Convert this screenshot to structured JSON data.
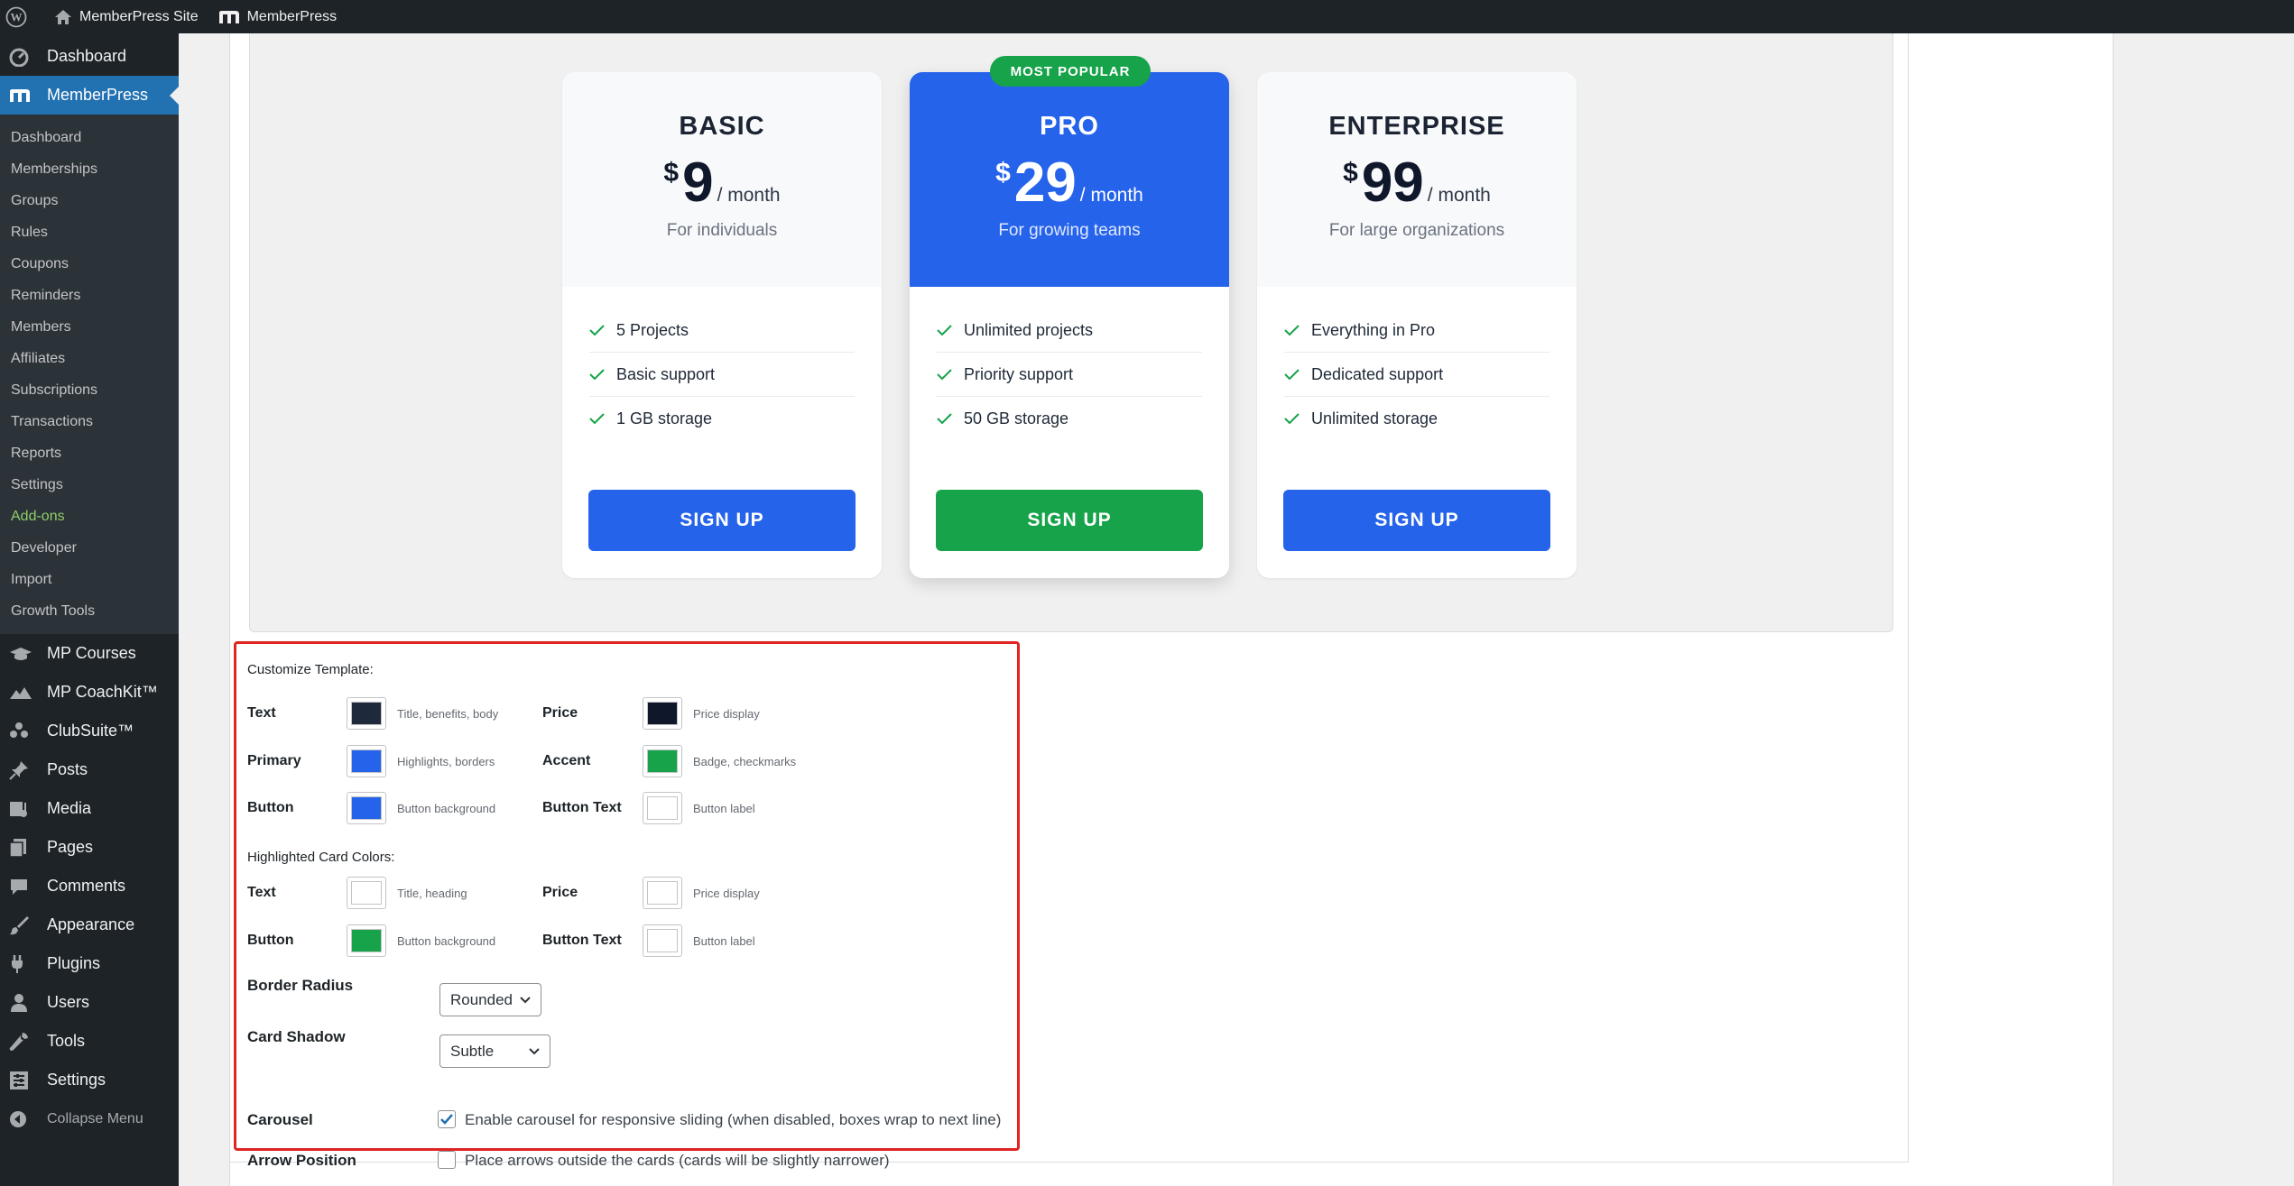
{
  "adminbar": {
    "site_name": "MemberPress Site",
    "plugin_name": "MemberPress"
  },
  "sidebar": {
    "top_items": [
      {
        "label": "Dashboard",
        "icon": "dashboard-icon"
      },
      {
        "label": "MemberPress",
        "icon": "memberpress-icon",
        "current": true
      }
    ],
    "sub_items": [
      "Dashboard",
      "Memberships",
      "Groups",
      "Rules",
      "Coupons",
      "Reminders",
      "Members",
      "Affiliates",
      "Subscriptions",
      "Transactions",
      "Reports",
      "Settings",
      "Add-ons",
      "Developer",
      "Import",
      "Growth Tools"
    ],
    "bottom_items": [
      {
        "label": "MP Courses",
        "icon": "courses-icon"
      },
      {
        "label": "MP CoachKit™",
        "icon": "coachkit-icon"
      },
      {
        "label": "ClubSuite™",
        "icon": "clubsuite-icon"
      },
      {
        "label": "Posts",
        "icon": "pin-icon"
      },
      {
        "label": "Media",
        "icon": "media-icon"
      },
      {
        "label": "Pages",
        "icon": "pages-icon"
      },
      {
        "label": "Comments",
        "icon": "comment-icon"
      },
      {
        "label": "Appearance",
        "icon": "brush-icon"
      },
      {
        "label": "Plugins",
        "icon": "plugin-icon"
      },
      {
        "label": "Users",
        "icon": "user-icon"
      },
      {
        "label": "Tools",
        "icon": "wrench-icon"
      },
      {
        "label": "Settings",
        "icon": "settings-icon"
      }
    ],
    "collapse_label": "Collapse Menu"
  },
  "pricing": {
    "badge": "MOST POPULAR",
    "plans": [
      {
        "title": "BASIC",
        "currency": "$",
        "amount": "9",
        "period": "/ month",
        "desc": "For individuals",
        "features": [
          "5 Projects",
          "Basic support",
          "1 GB storage"
        ],
        "button": "SIGN UP"
      },
      {
        "title": "PRO",
        "currency": "$",
        "amount": "29",
        "period": "/ month",
        "desc": "For growing teams",
        "features": [
          "Unlimited projects",
          "Priority support",
          "50 GB storage"
        ],
        "button": "SIGN UP"
      },
      {
        "title": "ENTERPRISE",
        "currency": "$",
        "amount": "99",
        "period": "/ month",
        "desc": "For large organizations",
        "features": [
          "Everything in Pro",
          "Dedicated support",
          "Unlimited storage"
        ],
        "button": "SIGN UP"
      }
    ]
  },
  "customize": {
    "title": "Customize Template:",
    "colors": [
      {
        "label": "Text",
        "hint": "Title, benefits, body",
        "color": "#1e293b"
      },
      {
        "label": "Price",
        "hint": "Price display",
        "color": "#0f172a"
      },
      {
        "label": "Primary",
        "hint": "Highlights, borders",
        "color": "#2563eb"
      },
      {
        "label": "Accent",
        "hint": "Badge, checkmarks",
        "color": "#16a34a"
      },
      {
        "label": "Button",
        "hint": "Button background",
        "color": "#2563eb"
      },
      {
        "label": "Button Text",
        "hint": "Button label",
        "color": "#ffffff"
      }
    ],
    "highlight_title": "Highlighted Card Colors:",
    "highlight_colors": [
      {
        "label": "Text",
        "hint": "Title, heading",
        "color": "#ffffff"
      },
      {
        "label": "Price",
        "hint": "Price display",
        "color": "#ffffff"
      },
      {
        "label": "Button",
        "hint": "Button background",
        "color": "#16a34a"
      },
      {
        "label": "Button Text",
        "hint": "Button label",
        "color": "#ffffff"
      }
    ],
    "border_radius": {
      "label": "Border Radius",
      "value": "Rounded"
    },
    "card_shadow": {
      "label": "Card Shadow",
      "value": "Subtle"
    },
    "carousel": {
      "label": "Carousel",
      "text": "Enable carousel for responsive sliding (when disabled, boxes wrap to next line)",
      "checked": true
    },
    "arrow_position": {
      "label": "Arrow Position",
      "text": "Place arrows outside the cards (cards will be slightly narrower)",
      "checked": false
    }
  }
}
